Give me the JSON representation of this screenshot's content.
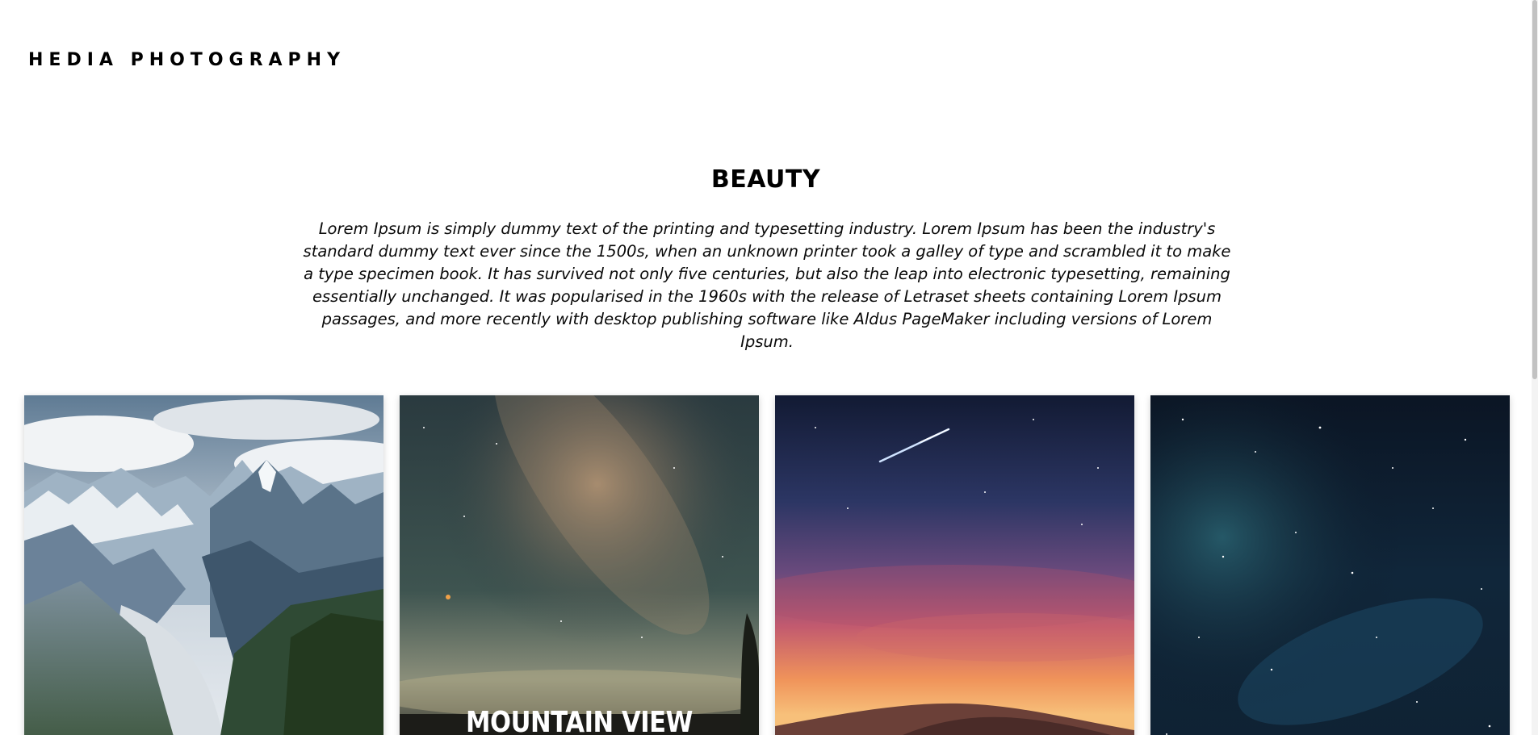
{
  "header": {
    "brand": "HEDIA PHOTOGRAPHY"
  },
  "section": {
    "title": "BEAUTY",
    "description": "Lorem Ipsum is simply dummy text of the printing and typesetting industry. Lorem Ipsum has been the industry's standard dummy text ever since the 1500s, when an unknown printer took a galley of type and scrambled it to make a type specimen book. It has survived not only five centuries, but also the leap into electronic typesetting, remaining essentially unchanged. It was popularised in the 1960s with the release of Letraset sheets containing Lorem Ipsum passages, and more recently with desktop publishing software like Aldus PageMaker including versions of Lorem Ipsum."
  },
  "gallery": {
    "cards": [
      {
        "subject": "snowy mountain range",
        "caption": ""
      },
      {
        "subject": "milky way night sky",
        "caption": "MOUNTAIN VIEW"
      },
      {
        "subject": "desert sunset with shooting star",
        "caption": ""
      },
      {
        "subject": "starry night sky",
        "caption": ""
      }
    ]
  },
  "colors": {
    "background": "#ffffff",
    "text": "#000000",
    "scrollbar_track": "#f3f3f3",
    "scrollbar_thumb": "#c2c2c2"
  }
}
